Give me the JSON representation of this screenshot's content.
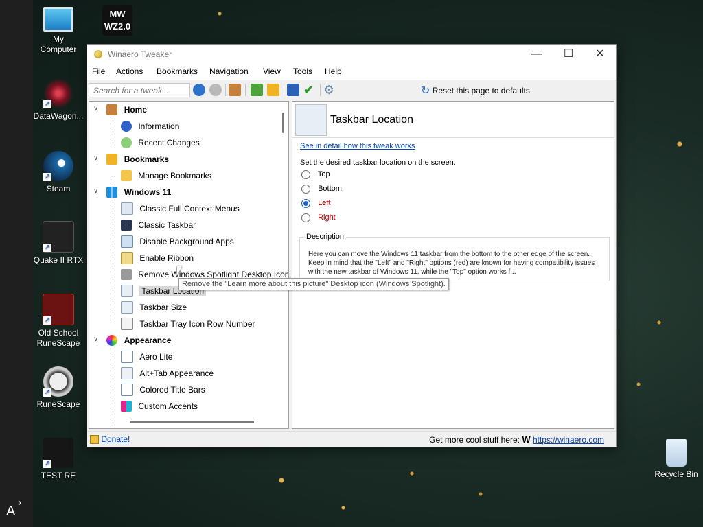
{
  "desktop": {
    "icons": [
      {
        "label": "My\nComputer",
        "icon": "monitor-icon"
      },
      {
        "label": "DataWagon...",
        "icon": "datawagon-icon"
      },
      {
        "label": "Steam",
        "icon": "steam-icon"
      },
      {
        "label": "Quake II RTX",
        "icon": "quake-icon"
      },
      {
        "label": "Old School\nRuneScape",
        "icon": "osrs-icon"
      },
      {
        "label": "RuneScape",
        "icon": "runescape-icon"
      },
      {
        "label": "TEST RE",
        "icon": "test-re-icon"
      },
      {
        "label": "Recycle Bin",
        "icon": "recycle-bin-icon"
      }
    ],
    "mw_icon_text": "MW\nWZ2.0",
    "taskbar_letter": "A"
  },
  "window": {
    "title": "Winaero Tweaker",
    "menu": [
      "File",
      "Actions",
      "Bookmarks",
      "Navigation",
      "View",
      "Tools",
      "Help"
    ],
    "search_placeholder": "Search for a tweak...",
    "reset_label": "Reset this page to defaults"
  },
  "tree": {
    "categories": [
      {
        "label": "Home",
        "items": [
          "Information",
          "Recent Changes"
        ]
      },
      {
        "label": "Bookmarks",
        "items": [
          "Manage Bookmarks"
        ]
      },
      {
        "label": "Windows 11",
        "items": [
          "Classic Full Context Menus",
          "Classic Taskbar",
          "Disable Background Apps",
          "Enable Ribbon",
          "Remove Windows Spotlight Desktop Icon",
          "Taskbar Location",
          "Taskbar Size",
          "Taskbar Tray Icon Row Number"
        ]
      },
      {
        "label": "Appearance",
        "items": [
          "Aero Lite",
          "Alt+Tab Appearance",
          "Colored Title Bars",
          "Custom Accents"
        ]
      }
    ],
    "tooltip": "Remove the \"Learn more about this picture\" Desktop icon (Windows Spotlight)."
  },
  "detail": {
    "title": "Taskbar Location",
    "link": "See in detail how this tweak works",
    "instruction": "Set the desired taskbar location on the screen.",
    "options": [
      {
        "label": "Top",
        "checked": false,
        "color": "#000000"
      },
      {
        "label": "Bottom",
        "checked": false,
        "color": "#000000"
      },
      {
        "label": "Left",
        "checked": true,
        "color": "#c00000"
      },
      {
        "label": "Right",
        "checked": false,
        "color": "#c00000"
      }
    ],
    "description_label": "Description",
    "description_text": "Here you can move the Windows 11 taskbar from the bottom to the other edge of the screen. Keep in mind that the \"Left\" and \"Right\" options (red) are known for having compatibility issues with the new taskbar of Windows 11, while the \"Top\" option works f..."
  },
  "status": {
    "donate": "Donate!",
    "more_text": "Get more cool stuff here:",
    "more_link": "https://winaero.com"
  }
}
